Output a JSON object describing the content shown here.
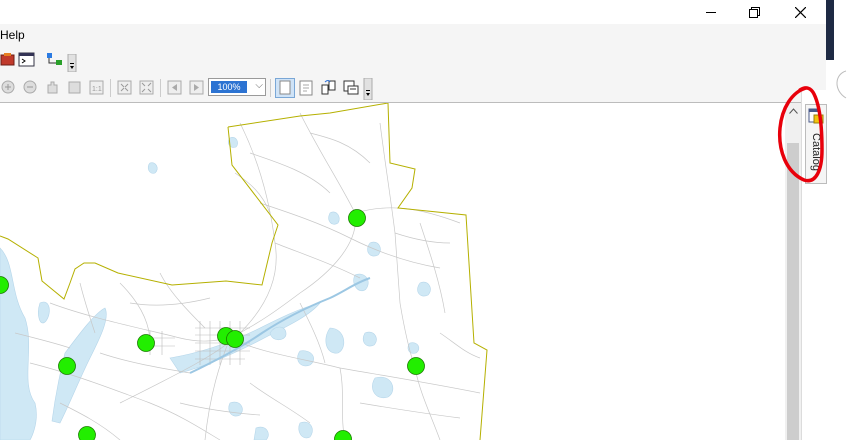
{
  "window": {
    "minimize_label": "—",
    "restore_label": "❐",
    "close_label": "✕"
  },
  "menu": {
    "help_label": "Help"
  },
  "toolbar": {
    "zoom_value": "100%"
  },
  "catalog_tab": {
    "label": "Catalog"
  },
  "map": {
    "boundary_color": "#b5b000",
    "point_color": "#22ee00",
    "water_color": "#cfe8f5",
    "road_color": "#c8c8c8"
  },
  "annotation": {
    "circle_color": "#e8000b"
  }
}
